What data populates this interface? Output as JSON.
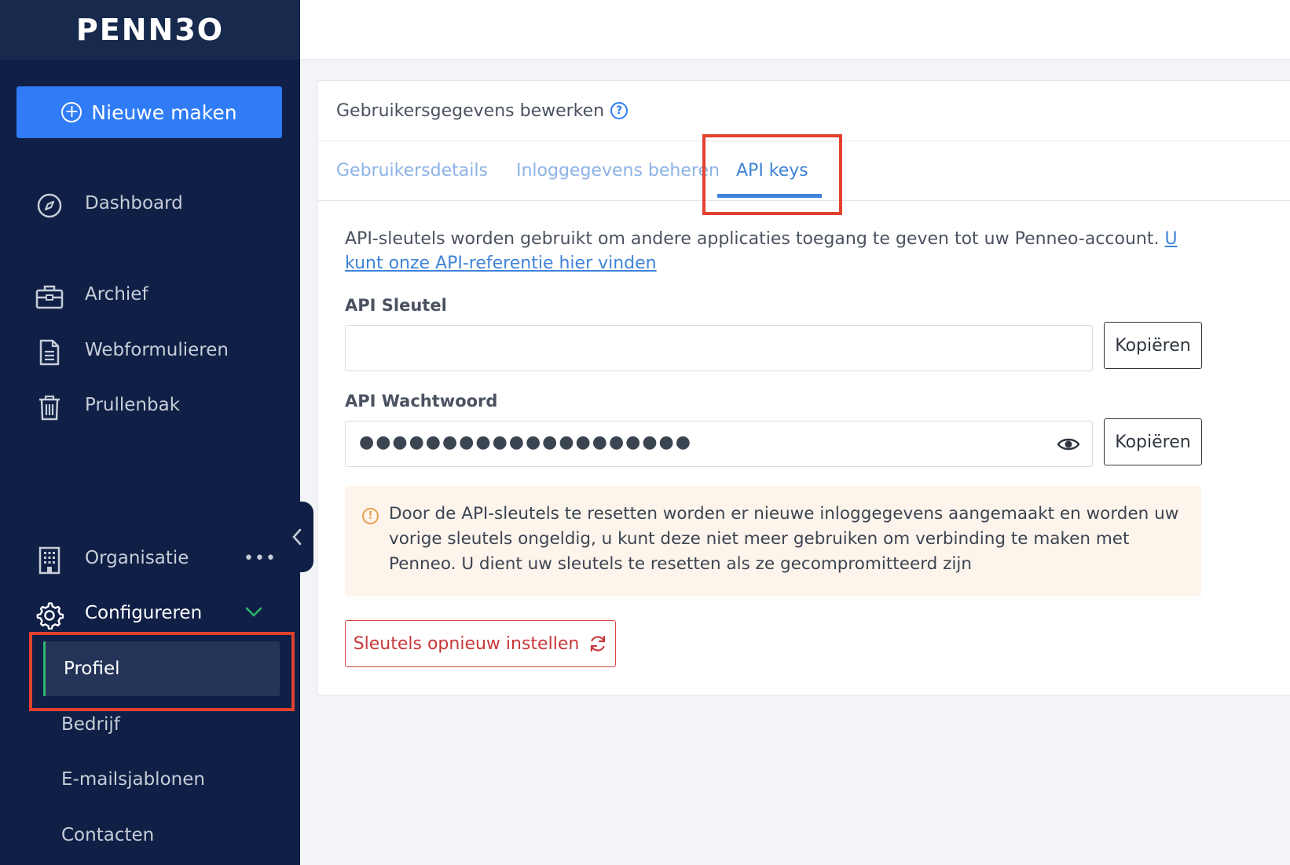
{
  "app": {
    "logo": "PENN3O"
  },
  "sidebar": {
    "new_button": "Nieuwe maken",
    "items": [
      {
        "label": "Dashboard",
        "icon": "compass-icon"
      },
      {
        "label": "Archief",
        "icon": "briefcase-icon"
      },
      {
        "label": "Webformulieren",
        "icon": "document-icon"
      },
      {
        "label": "Prullenbak",
        "icon": "trash-icon"
      },
      {
        "label": "Organisatie",
        "icon": "building-icon",
        "more": "•••"
      },
      {
        "label": "Configureren",
        "icon": "gear-icon"
      }
    ],
    "sub_items": [
      {
        "label": "Profiel",
        "selected": true
      },
      {
        "label": "Bedrijf"
      },
      {
        "label": "E-mailsjablonen"
      },
      {
        "label": "Contacten"
      }
    ]
  },
  "card": {
    "title": "Gebruikersgegevens bewerken",
    "help": "?",
    "tabs": [
      {
        "label": "Gebruikersdetails"
      },
      {
        "label": "Inloggegevens beheren"
      },
      {
        "label": "API keys",
        "active": true
      }
    ],
    "description": "API-sleutels worden gebruikt om andere applicaties toegang te geven tot uw Penneo-account. ",
    "description_link": "U kunt onze API-referentie hier vinden",
    "api_key": {
      "label": "API Sleutel",
      "value": "",
      "copy": "Kopiëren"
    },
    "api_password": {
      "label": "API Wachtwoord",
      "value": "●●●●●●●●●●●●●●●●●●●●",
      "copy": "Kopiëren"
    },
    "warning": {
      "icon": "!",
      "text": "Door de API-sleutels te resetten worden er nieuwe inloggegevens aangemaakt en worden uw vorige sleutels ongeldig, u kunt deze niet meer gebruiken om verbinding te maken met Penneo. U dient uw sleutels te resetten als ze gecompromitteerd zijn"
    },
    "reset_button": "Sleutels opnieuw instellen"
  },
  "colors": {
    "sidebar_bg": "#0f1f45",
    "primary": "#2f7cf6",
    "tab_active": "#3f84d8",
    "highlight": "#e1412f",
    "danger": "#c9383a",
    "warning_bg": "#fdf4ec",
    "selected_marker": "#2fb76b"
  }
}
